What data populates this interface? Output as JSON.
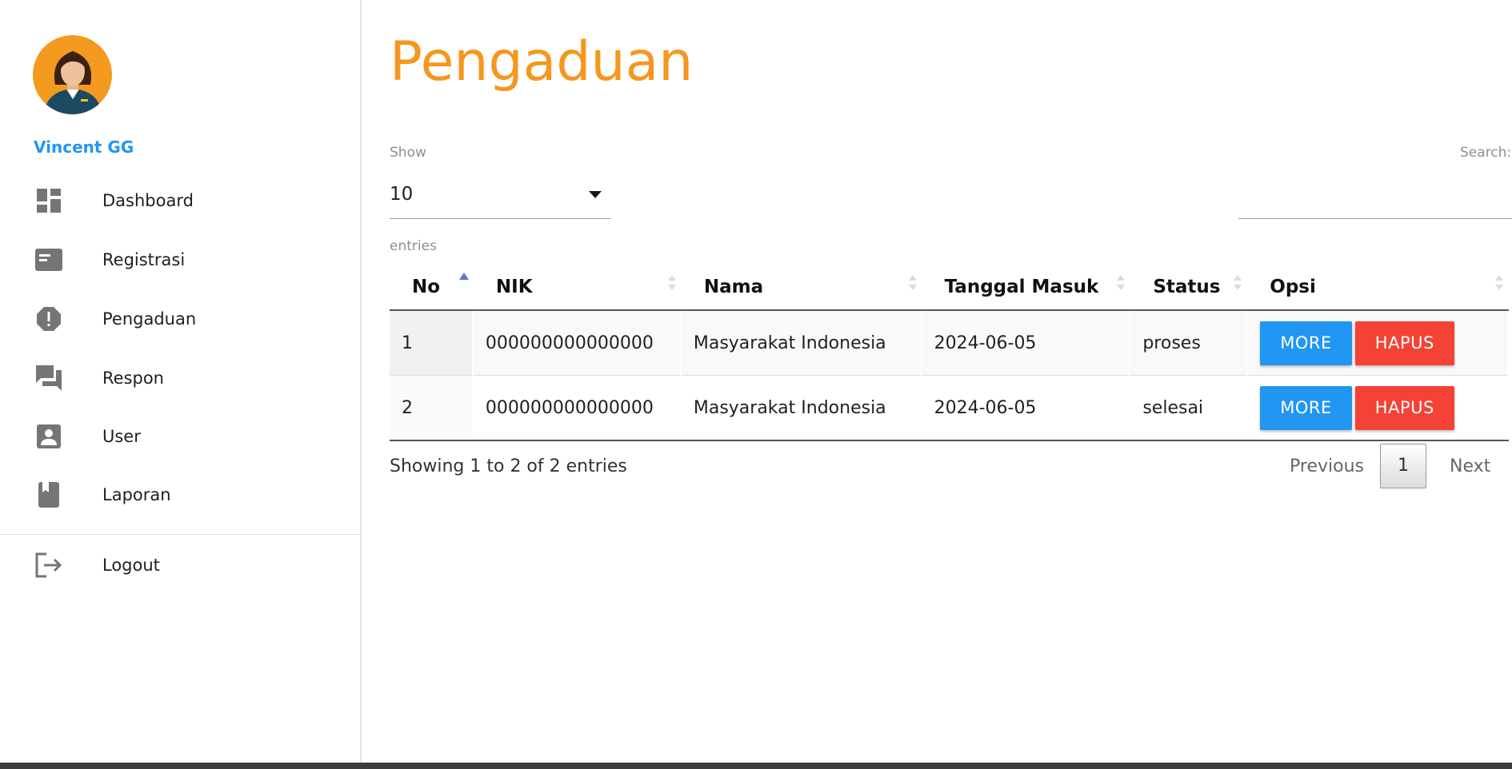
{
  "sidebar": {
    "user_name": "Vincent GG",
    "items": [
      {
        "label": "Dashboard",
        "icon": "dashboard-icon"
      },
      {
        "label": "Registrasi",
        "icon": "id-card-icon"
      },
      {
        "label": "Pengaduan",
        "icon": "report-icon"
      },
      {
        "label": "Respon",
        "icon": "chat-icon"
      },
      {
        "label": "User",
        "icon": "account-box-icon"
      },
      {
        "label": "Laporan",
        "icon": "book-icon"
      }
    ],
    "logout": {
      "label": "Logout",
      "icon": "logout-icon"
    }
  },
  "main": {
    "title": "Pengaduan",
    "show_label": "Show",
    "page_length": "10",
    "entries_label": "entries",
    "search_label": "Search:",
    "search_value": ""
  },
  "table": {
    "columns": [
      "No",
      "NIK",
      "Nama",
      "Tanggal Masuk",
      "Status",
      "Opsi"
    ],
    "rows": [
      {
        "no": "1",
        "nik": "000000000000000",
        "nama": "Masyarakat Indonesia",
        "tanggal": "2024-06-05",
        "status": "proses"
      },
      {
        "no": "2",
        "nik": "000000000000000",
        "nama": "Masyarakat Indonesia",
        "tanggal": "2024-06-05",
        "status": "selesai"
      }
    ],
    "more_label": "MORE",
    "hapus_label": "HAPUS"
  },
  "footer": {
    "info": "Showing 1 to 2 of 2 entries",
    "previous": "Previous",
    "current_page": "1",
    "next": "Next"
  },
  "colors": {
    "accent_title": "#f5971e",
    "user_name": "#2196f3",
    "more_button": "#2196f3",
    "hapus_button": "#f44336",
    "avatar_bg": "#f39a1f"
  }
}
